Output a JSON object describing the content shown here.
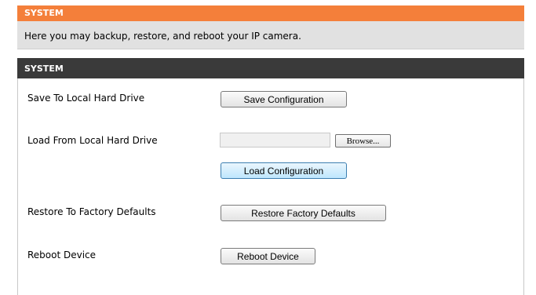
{
  "top_section": {
    "title": "SYSTEM",
    "description": "Here you may backup, restore, and reboot your IP camera."
  },
  "panel": {
    "title": "SYSTEM",
    "save": {
      "label": "Save To Local Hard Drive",
      "button": "Save Configuration"
    },
    "load": {
      "label": "Load From Local Hard Drive",
      "file_value": "",
      "browse": "Browse...",
      "button": "Load Configuration"
    },
    "restore": {
      "label": "Restore To Factory Defaults",
      "button": "Restore Factory Defaults"
    },
    "reboot": {
      "label": "Reboot Device",
      "button": "Reboot Device"
    }
  },
  "colors": {
    "top_header_bg": "#f47f3a",
    "intro_bg": "#e1e1e1",
    "panel_header_bg": "#3a3a3a"
  }
}
